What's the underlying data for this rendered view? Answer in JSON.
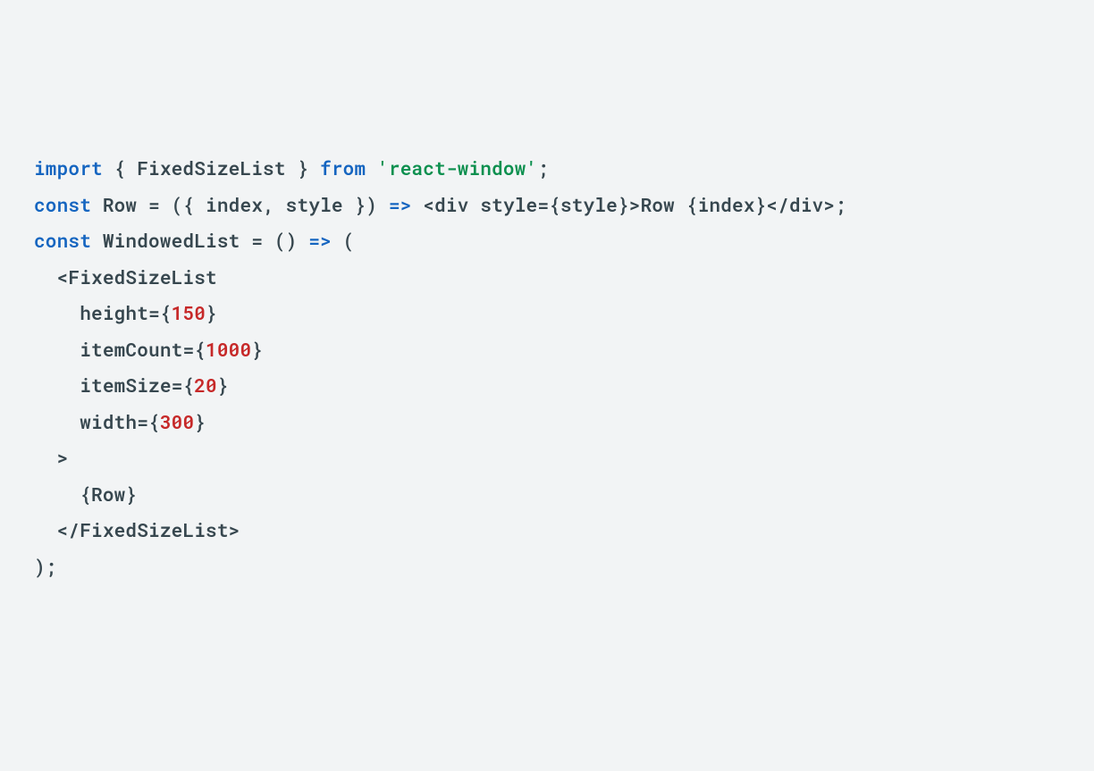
{
  "code": {
    "line1": {
      "import_kw": "import",
      "open_brace": " { ",
      "ident": "FixedSizeList",
      "close_brace": " } ",
      "from_kw": "from",
      "space": " ",
      "str": "'react-window'",
      "semi": ";"
    },
    "line2": "",
    "line3": {
      "const_kw": "const",
      "sp1": " ",
      "row": "Row",
      "eq": " = ({ ",
      "index": "index",
      "comma": ", ",
      "style": "style",
      "close": " }) ",
      "arrow": "=>",
      "sp2": " ",
      "divopen": "<div style={style}>",
      "rowtxt": "Row ",
      "idxexpr": "{index}",
      "divclose": "</div>",
      "semi": ";"
    },
    "line4": "",
    "line5": {
      "const_kw": "const",
      "sp1": " ",
      "name": "WindowedList",
      "eq": " = () ",
      "arrow": "=>",
      "paren": " ("
    },
    "line6": {
      "indent": "  ",
      "tag": "<FixedSizeList"
    },
    "line7": {
      "indent": "    ",
      "attr": "height",
      "eq": "={",
      "val": "150",
      "close": "}"
    },
    "line8": {
      "indent": "    ",
      "attr": "itemCount",
      "eq": "={",
      "val": "1000",
      "close": "}"
    },
    "line9": {
      "indent": "    ",
      "attr": "itemSize",
      "eq": "={",
      "val": "20",
      "close": "}"
    },
    "line10": {
      "indent": "    ",
      "attr": "width",
      "eq": "={",
      "val": "300",
      "close": "}"
    },
    "line11": {
      "indent": "  ",
      "gt": ">"
    },
    "line12": {
      "indent": "    ",
      "expr": "{Row}"
    },
    "line13": {
      "indent": "  ",
      "close": "</FixedSizeList>"
    },
    "line14": {
      "close": ");"
    }
  }
}
